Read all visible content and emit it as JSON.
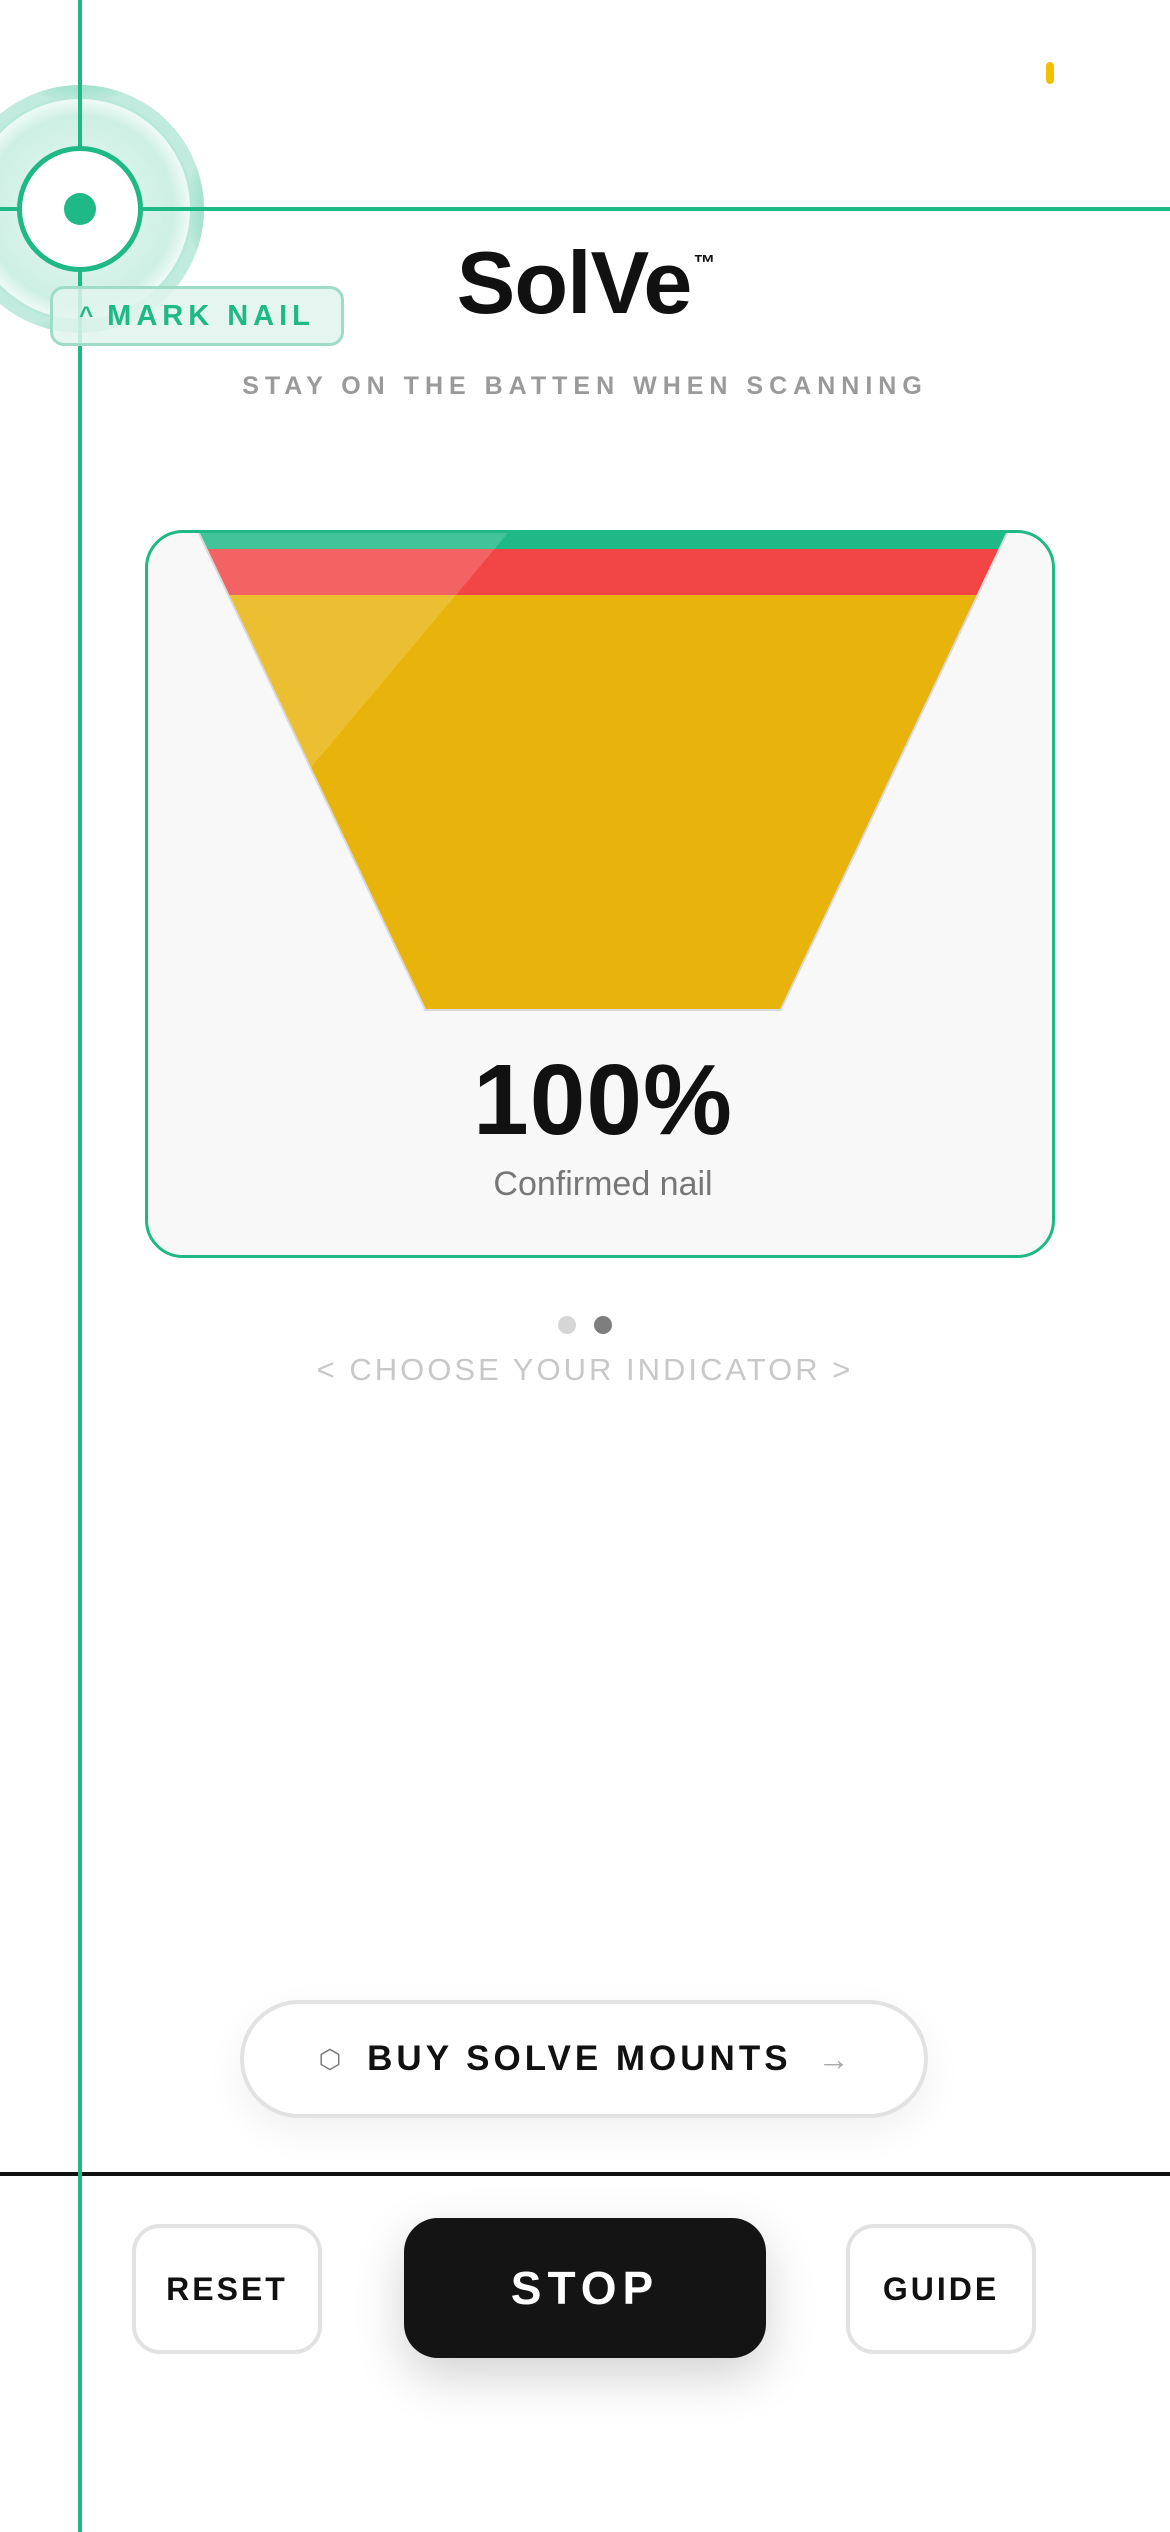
{
  "header": {
    "brand": "SolVe",
    "trademark": "™",
    "subtitle": "STAY ON THE BATTEN WHEN SCANNING"
  },
  "mark_nail": {
    "icon": "caret-up-icon",
    "label": "MARK NAIL"
  },
  "indicator": {
    "percent_label": "100%",
    "status": "Confirmed nail",
    "level": 1.0,
    "colors": {
      "top": "#1fb887",
      "middle": "#f24646",
      "fill": "#e8b30a",
      "card_border": "#1fb887"
    }
  },
  "pager": {
    "total": 2,
    "active_index": 1,
    "hint": "< CHOOSE YOUR INDICATOR >"
  },
  "buy_button": {
    "icon": "hexagon-icon",
    "label": "BUY SOLVE MOUNTS",
    "arrow": "→"
  },
  "controls": {
    "reset": "RESET",
    "stop": "STOP",
    "guide": "GUIDE"
  },
  "accent_color": "#1fb887"
}
